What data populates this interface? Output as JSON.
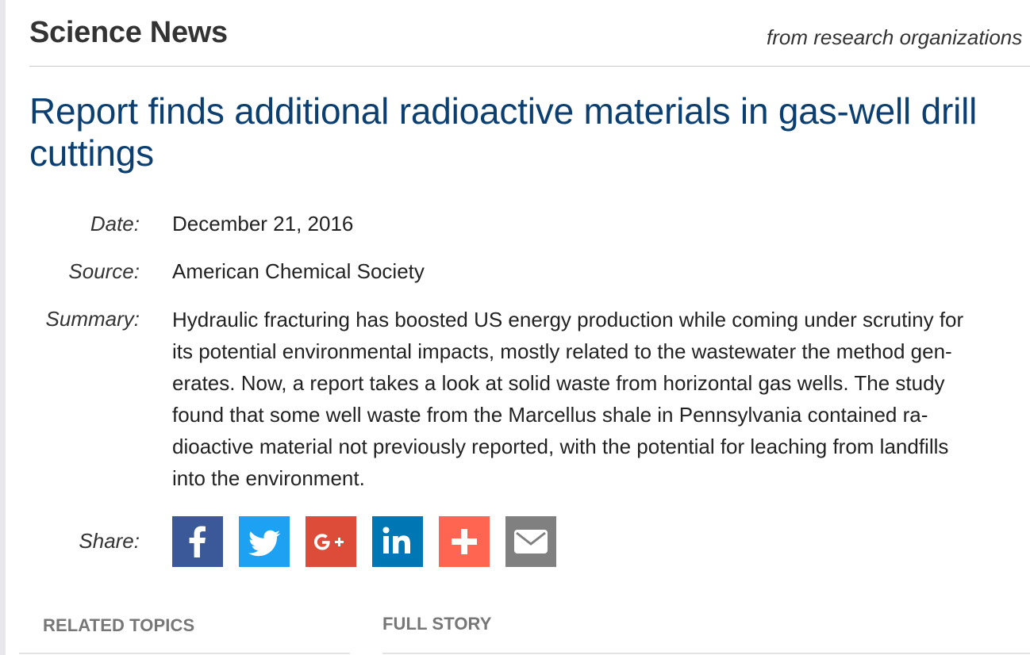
{
  "site": {
    "name": "Science News",
    "tagline": "from research organizations"
  },
  "article": {
    "headline": "Report finds additional radioactive materials in gas-well drill cuttings",
    "date_label": "Date:",
    "date": "December 21, 2016",
    "source_label": "Source:",
    "source": "American Chemical Society",
    "summary_label": "Summary:",
    "summary_lines": [
      "Hydraulic fracturing has boosted US energy production while coming under scrutiny for",
      "its potential environmental impacts, mostly related to the wastewater the method gen-",
      "erates. Now, a report takes a look at solid waste from horizontal gas wells. The study",
      "found that some well waste from the Marcellus shale in Pennsylvania contained ra-",
      "dioactive material not previously reported, with the potential for leaching from landfills",
      "into the environment."
    ]
  },
  "share": {
    "label": "Share:",
    "buttons": [
      {
        "name": "facebook",
        "icon": "facebook-icon",
        "color": "#3b5998"
      },
      {
        "name": "twitter",
        "icon": "twitter-icon",
        "color": "#1da1f2"
      },
      {
        "name": "google-plus",
        "icon": "google-plus-icon",
        "color": "#dd4b39"
      },
      {
        "name": "linkedin",
        "icon": "linkedin-icon",
        "color": "#0077b5"
      },
      {
        "name": "more",
        "icon": "plus-icon",
        "color": "#ff6550"
      },
      {
        "name": "email",
        "icon": "envelope-icon",
        "color": "#808080"
      }
    ]
  },
  "sections": {
    "related_topics": "RELATED TOPICS",
    "full_story": "FULL STORY"
  },
  "colors": {
    "headline": "#0b3f72",
    "text": "#222222"
  }
}
